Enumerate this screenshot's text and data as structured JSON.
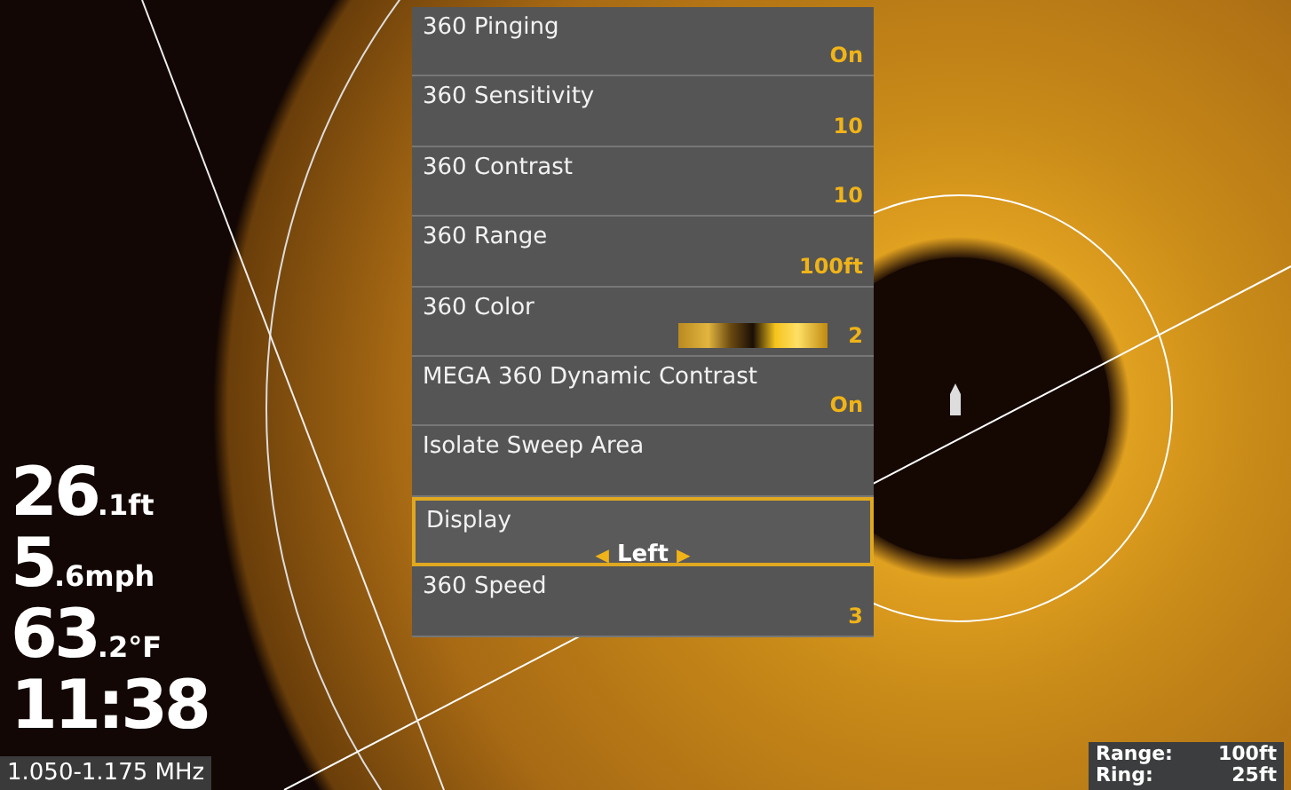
{
  "menu": {
    "items": [
      {
        "label": "360 Pinging",
        "kind": "value",
        "value": "On",
        "selected": false
      },
      {
        "label": "360 Sensitivity",
        "kind": "value",
        "value": "10",
        "selected": false
      },
      {
        "label": "360 Contrast",
        "kind": "value",
        "value": "10",
        "selected": false
      },
      {
        "label": "360 Range",
        "kind": "value",
        "value": "100ft",
        "selected": false
      },
      {
        "label": "360 Color",
        "kind": "palette",
        "value": "2",
        "selected": false
      },
      {
        "label": "MEGA 360 Dynamic Contrast",
        "kind": "value",
        "value": "On",
        "selected": false
      },
      {
        "label": "Isolate Sweep Area",
        "kind": "action",
        "selected": false
      },
      {
        "label": "Display",
        "kind": "selector",
        "value": "Left",
        "prev": "◀",
        "next": "▶",
        "selected": true
      },
      {
        "label": "360 Speed",
        "kind": "value",
        "value": "3",
        "selected": false
      }
    ]
  },
  "readouts": [
    {
      "big": "26",
      "small": ".1ft"
    },
    {
      "big": "5",
      "small": ".6mph"
    },
    {
      "big": "63",
      "small": ".2°F"
    },
    {
      "big": "11:38"
    }
  ],
  "frequency": "1.050-1.175 MHz",
  "range_box": [
    {
      "label": "Range:",
      "value": "100ft"
    },
    {
      "label": "Ring:",
      "value": "25ft"
    }
  ]
}
